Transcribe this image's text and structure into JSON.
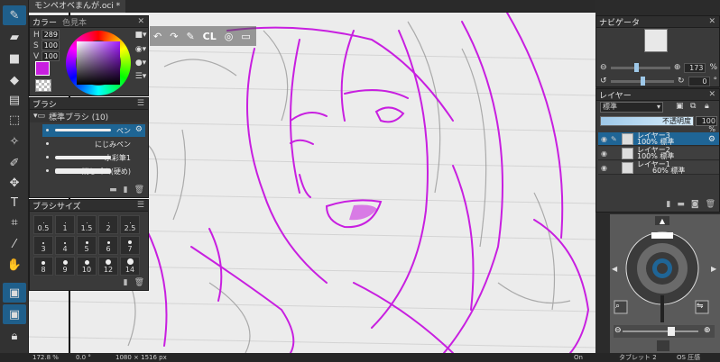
{
  "file_tab": {
    "label": "モンペオベまんが.oci *"
  },
  "color_panel": {
    "tabs": [
      "カラー",
      "色見本"
    ],
    "hsv": [
      {
        "label": "H",
        "value": "289"
      },
      {
        "label": "S",
        "value": "100"
      },
      {
        "label": "V",
        "value": "100"
      }
    ],
    "foreground_color": "#c81fe0"
  },
  "brush_panel": {
    "title": "ブラシ",
    "category": "標準ブラシ (10)",
    "items": [
      {
        "label": "ペン",
        "selected": true
      },
      {
        "label": "にじみペン",
        "selected": false
      },
      {
        "label": "水彩筆1",
        "selected": false
      },
      {
        "label": "消しゴム(硬め)",
        "selected": false
      }
    ]
  },
  "size_panel": {
    "title": "ブラシサイズ",
    "sizes": [
      "0.5",
      "1",
      "1.5",
      "2",
      "2.5",
      "3",
      "4",
      "5",
      "6",
      "7",
      "8",
      "9",
      "10",
      "12",
      "14"
    ]
  },
  "command_bar": {
    "cl_label": "CL"
  },
  "navigator": {
    "title": "ナビゲータ",
    "zoom": "173",
    "zoom_unit": "%",
    "rotation": "0",
    "rotation_unit": "°"
  },
  "layers": {
    "title": "レイヤー",
    "blend_mode": "標準",
    "opacity_label": "不透明度",
    "opacity_value": "100 %",
    "items": [
      {
        "name": "レイヤー3",
        "info": "100% 標準",
        "selected": true
      },
      {
        "name": "レイヤー2",
        "info": "100% 標準",
        "selected": false
      },
      {
        "name": "レイヤー1",
        "info": "60% 標準",
        "selected": false
      }
    ]
  },
  "status_bar": {
    "zoom": "172.8 %",
    "angle": "0.0 °",
    "size": "1080 × 1516 px",
    "on": "On",
    "tablet": "タブレット 2",
    "os_pressure": "OS 圧感"
  },
  "colors": {
    "accent": "#1f6596",
    "stroke": "#c81fe0",
    "panel_bg": "#3a3a3a"
  }
}
